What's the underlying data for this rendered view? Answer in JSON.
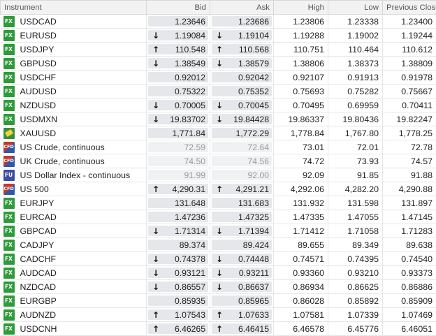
{
  "headers": {
    "instrument": "Instrument",
    "bid": "Bid",
    "ask": "Ask",
    "high": "High",
    "low": "Low",
    "prev": "Previous Close"
  },
  "rows": [
    {
      "type": "fx",
      "icon": "FX",
      "name": "USDCAD",
      "bid": "1.23646",
      "ask": "1.23686",
      "arrow": "none",
      "muted": false,
      "high": "1.23806",
      "low": "1.23338",
      "prev": "1.23400"
    },
    {
      "type": "fx",
      "icon": "FX",
      "name": "EURUSD",
      "bid": "1.19084",
      "ask": "1.19104",
      "arrow": "down",
      "muted": false,
      "high": "1.19288",
      "low": "1.19002",
      "prev": "1.19244"
    },
    {
      "type": "fx",
      "icon": "FX",
      "name": "USDJPY",
      "bid": "110.548",
      "ask": "110.568",
      "arrow": "up",
      "muted": false,
      "high": "110.751",
      "low": "110.464",
      "prev": "110.612"
    },
    {
      "type": "fx",
      "icon": "FX",
      "name": "GBPUSD",
      "bid": "1.38549",
      "ask": "1.38579",
      "arrow": "down",
      "muted": false,
      "high": "1.38806",
      "low": "1.38373",
      "prev": "1.38809"
    },
    {
      "type": "fx",
      "icon": "FX",
      "name": "USDCHF",
      "bid": "0.92012",
      "ask": "0.92042",
      "arrow": "none",
      "muted": false,
      "high": "0.92107",
      "low": "0.91913",
      "prev": "0.91978"
    },
    {
      "type": "fx",
      "icon": "FX",
      "name": "AUDUSD",
      "bid": "0.75322",
      "ask": "0.75352",
      "arrow": "none",
      "muted": false,
      "high": "0.75693",
      "low": "0.75282",
      "prev": "0.75667"
    },
    {
      "type": "fx",
      "icon": "FX",
      "name": "NZDUSD",
      "bid": "0.70005",
      "ask": "0.70045",
      "arrow": "down",
      "muted": false,
      "high": "0.70495",
      "low": "0.69959",
      "prev": "0.70411"
    },
    {
      "type": "fx",
      "icon": "FX",
      "name": "USDMXN",
      "bid": "19.83702",
      "ask": "19.84428",
      "arrow": "down",
      "muted": false,
      "high": "19.86337",
      "low": "19.80436",
      "prev": "19.82247"
    },
    {
      "type": "com",
      "icon": "",
      "name": "XAUUSD",
      "bid": "1,771.84",
      "ask": "1,772.29",
      "arrow": "none",
      "muted": false,
      "high": "1,778.84",
      "low": "1,767.80",
      "prev": "1,778.25"
    },
    {
      "type": "cfd",
      "icon": "CFD",
      "name": "US Crude, continuous",
      "bid": "72.59",
      "ask": "72.64",
      "arrow": "none",
      "muted": true,
      "high": "73.01",
      "low": "72.01",
      "prev": "72.78"
    },
    {
      "type": "cfd",
      "icon": "CFD",
      "name": "UK Crude, continuous",
      "bid": "74.50",
      "ask": "74.56",
      "arrow": "none",
      "muted": true,
      "high": "74.72",
      "low": "73.93",
      "prev": "74.57"
    },
    {
      "type": "fu",
      "icon": "FU",
      "name": "US Dollar Index - continuous",
      "bid": "91.99",
      "ask": "92.00",
      "arrow": "none",
      "muted": true,
      "high": "92.09",
      "low": "91.85",
      "prev": "91.88"
    },
    {
      "type": "cfd",
      "icon": "CFD",
      "name": "US 500",
      "bid": "4,290.31",
      "ask": "4,291.21",
      "arrow": "up",
      "muted": false,
      "high": "4,292.06",
      "low": "4,282.20",
      "prev": "4,290.88"
    },
    {
      "type": "fx",
      "icon": "FX",
      "name": "EURJPY",
      "bid": "131.648",
      "ask": "131.683",
      "arrow": "none",
      "muted": false,
      "high": "131.932",
      "low": "131.598",
      "prev": "131.897"
    },
    {
      "type": "fx",
      "icon": "FX",
      "name": "EURCAD",
      "bid": "1.47236",
      "ask": "1.47325",
      "arrow": "none",
      "muted": false,
      "high": "1.47335",
      "low": "1.47055",
      "prev": "1.47145"
    },
    {
      "type": "fx",
      "icon": "FX",
      "name": "GBPCAD",
      "bid": "1.71314",
      "ask": "1.71394",
      "arrow": "down",
      "muted": false,
      "high": "1.71412",
      "low": "1.71058",
      "prev": "1.71283"
    },
    {
      "type": "fx",
      "icon": "FX",
      "name": "CADJPY",
      "bid": "89.374",
      "ask": "89.424",
      "arrow": "none",
      "muted": false,
      "high": "89.655",
      "low": "89.349",
      "prev": "89.638"
    },
    {
      "type": "fx",
      "icon": "FX",
      "name": "CADCHF",
      "bid": "0.74378",
      "ask": "0.74448",
      "arrow": "down",
      "muted": false,
      "high": "0.74571",
      "low": "0.74395",
      "prev": "0.74540"
    },
    {
      "type": "fx",
      "icon": "FX",
      "name": "AUDCAD",
      "bid": "0.93121",
      "ask": "0.93211",
      "arrow": "down",
      "muted": false,
      "high": "0.93360",
      "low": "0.93210",
      "prev": "0.93373"
    },
    {
      "type": "fx",
      "icon": "FX",
      "name": "NZDCAD",
      "bid": "0.86557",
      "ask": "0.86637",
      "arrow": "down",
      "muted": false,
      "high": "0.86934",
      "low": "0.86625",
      "prev": "0.86886"
    },
    {
      "type": "fx",
      "icon": "FX",
      "name": "EURGBP",
      "bid": "0.85935",
      "ask": "0.85965",
      "arrow": "none",
      "muted": false,
      "high": "0.86028",
      "low": "0.85892",
      "prev": "0.85909"
    },
    {
      "type": "fx",
      "icon": "FX",
      "name": "AUDNZD",
      "bid": "1.07543",
      "ask": "1.07633",
      "arrow": "up",
      "muted": false,
      "high": "1.07581",
      "low": "1.07339",
      "prev": "1.07469"
    },
    {
      "type": "fx",
      "icon": "FX",
      "name": "USDCNH",
      "bid": "6.46265",
      "ask": "6.46415",
      "arrow": "up",
      "muted": false,
      "high": "6.46578",
      "low": "6.45776",
      "prev": "6.46051"
    }
  ]
}
